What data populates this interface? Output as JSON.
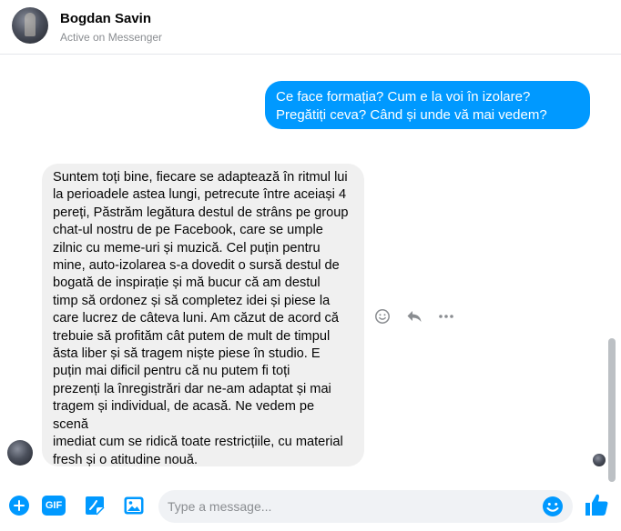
{
  "header": {
    "contact_name": "Bogdan Savin",
    "status": "Active on Messenger"
  },
  "messages": {
    "outgoing_1": "Ce face formația? Cum e la voi în izolare? Pregătiți ceva? Când și unde vă mai vedem?",
    "incoming_1": [
      "Suntem toți bine, fiecare se adaptează în ritmul lui",
      "la perioadele astea lungi, petrecute între aceiași 4",
      "pereți, Păstrăm legătura destul de strâns pe group",
      "chat-ul nostru de pe Facebook, care se umple",
      "zilnic cu meme-uri și muzică. Cel puțin pentru",
      "mine, auto-izolarea s-a dovedit o sursă destul de",
      "bogată de inspirație și mă bucur că am destul",
      "timp să ordonez și să completez idei și piese la",
      "care lucrez de câteva luni. Am căzut de acord că",
      "trebuie să profităm cât putem de mult de timpul",
      "ăsta liber și să tragem niște piese în studio. E",
      "puțin mai dificil pentru că nu putem fi toți",
      "prezenți la înregistrări dar ne-am adaptat și mai",
      "tragem și individual, de acasă. Ne vedem pe scenă",
      "imediat cum se ridică toate restricțiile, cu material",
      "fresh și o atitudine nouă."
    ]
  },
  "message_actions": [
    "react-icon",
    "reply-icon",
    "more-icon"
  ],
  "composer": {
    "placeholder": "Type a message...",
    "value": "",
    "gif_label": "GIF",
    "tools": [
      "plus-icon",
      "gif-icon",
      "sticker-icon",
      "photo-icon"
    ]
  },
  "colors": {
    "accent": "#0099ff",
    "incoming_bubble": "#f0f0f0",
    "like": "#0099ff"
  }
}
